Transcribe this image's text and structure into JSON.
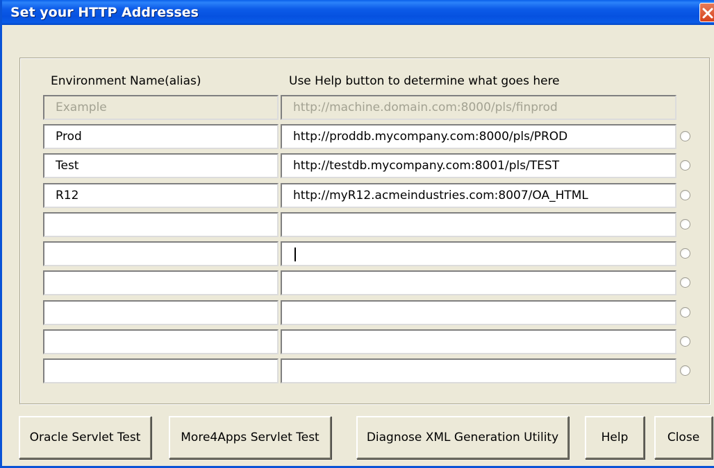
{
  "window": {
    "title": "Set your HTTP Addresses"
  },
  "labels": {
    "env_header": "Environment Name(alias)",
    "url_header": "Use Help button to determine what goes here"
  },
  "example_row": {
    "name": "Example",
    "url": "http://machine.domain.com:8000/pls/finprod"
  },
  "rows": [
    {
      "name": "Prod",
      "url": "http://proddb.mycompany.com:8000/pls/PROD"
    },
    {
      "name": "Test",
      "url": "http://testdb.mycompany.com:8001/pls/TEST"
    },
    {
      "name": "R12",
      "url": "http://myR12.acmeindustries.com:8007/OA_HTML"
    },
    {
      "name": "",
      "url": ""
    },
    {
      "name": "",
      "url": ""
    },
    {
      "name": "",
      "url": ""
    },
    {
      "name": "",
      "url": ""
    },
    {
      "name": "",
      "url": ""
    },
    {
      "name": "",
      "url": ""
    }
  ],
  "buttons": {
    "oracle": "Oracle Servlet Test",
    "more4apps": "More4Apps Servlet Test",
    "diagnose": "Diagnose XML Generation Utility",
    "help": "Help",
    "close": "Close"
  },
  "icons": {
    "close": "close-x-icon"
  }
}
